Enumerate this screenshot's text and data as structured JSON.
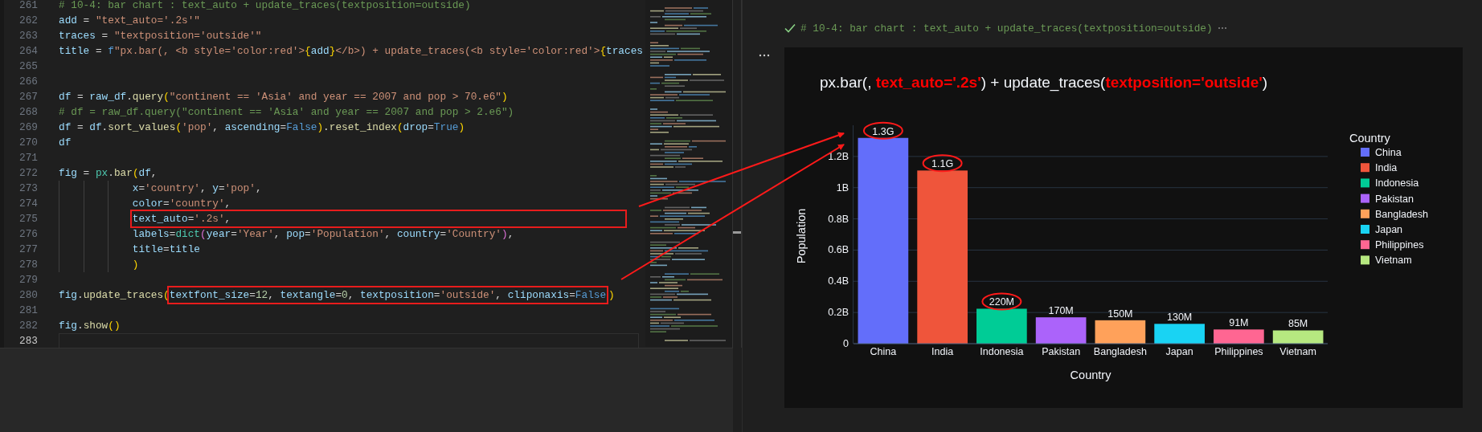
{
  "editor": {
    "lines": [
      {
        "number": "261",
        "current": false,
        "tokens": [
          {
            "kind": "comment",
            "text": "# 10-4: bar chart : text_auto + update_traces(textposition=outside)"
          }
        ]
      },
      {
        "number": "262",
        "current": false,
        "tokens": [
          {
            "kind": "var",
            "text": "add"
          },
          {
            "kind": "op",
            "text": " = "
          },
          {
            "kind": "str",
            "text": "\"text_auto='.2s'\""
          }
        ]
      },
      {
        "number": "263",
        "current": false,
        "tokens": [
          {
            "kind": "var",
            "text": "traces"
          },
          {
            "kind": "op",
            "text": " = "
          },
          {
            "kind": "str",
            "text": "\"textposition='outside'\""
          }
        ]
      },
      {
        "number": "264",
        "current": false,
        "tokens": [
          {
            "kind": "var",
            "text": "title"
          },
          {
            "kind": "op",
            "text": " = "
          },
          {
            "kind": "const",
            "text": "f"
          },
          {
            "kind": "str",
            "text": "\"px.bar(, <b style='color:red'>"
          },
          {
            "kind": "b1",
            "text": "{"
          },
          {
            "kind": "var",
            "text": "add"
          },
          {
            "kind": "b1",
            "text": "}"
          },
          {
            "kind": "str",
            "text": "</b>) + update_traces(<b style='color:red'>"
          },
          {
            "kind": "b1",
            "text": "{"
          },
          {
            "kind": "var",
            "text": "traces"
          }
        ]
      },
      {
        "number": "265",
        "current": false
      },
      {
        "number": "266",
        "current": false
      },
      {
        "number": "267",
        "current": false,
        "tokens": [
          {
            "kind": "var",
            "text": "df"
          },
          {
            "kind": "op",
            "text": " = "
          },
          {
            "kind": "var",
            "text": "raw_df"
          },
          {
            "kind": "op",
            "text": "."
          },
          {
            "kind": "func",
            "text": "query"
          },
          {
            "kind": "b1",
            "text": "("
          },
          {
            "kind": "str",
            "text": "\"continent == 'Asia' and year == 2007 and pop > 70.e6\""
          },
          {
            "kind": "b1",
            "text": ")"
          }
        ]
      },
      {
        "number": "268",
        "current": false,
        "tokens": [
          {
            "kind": "comment",
            "text": "# df = raw_df.query(\"continent == 'Asia' and year == 2007 and pop > 2.e6\")"
          }
        ]
      },
      {
        "number": "269",
        "current": false,
        "tokens": [
          {
            "kind": "var",
            "text": "df"
          },
          {
            "kind": "op",
            "text": " = "
          },
          {
            "kind": "var",
            "text": "df"
          },
          {
            "kind": "op",
            "text": "."
          },
          {
            "kind": "func",
            "text": "sort_values"
          },
          {
            "kind": "b1",
            "text": "("
          },
          {
            "kind": "str",
            "text": "'pop'"
          },
          {
            "kind": "op",
            "text": ", "
          },
          {
            "kind": "var",
            "text": "ascending"
          },
          {
            "kind": "op",
            "text": "="
          },
          {
            "kind": "const",
            "text": "False"
          },
          {
            "kind": "b1",
            "text": ")"
          },
          {
            "kind": "op",
            "text": "."
          },
          {
            "kind": "func",
            "text": "reset_index"
          },
          {
            "kind": "b1",
            "text": "("
          },
          {
            "kind": "var",
            "text": "drop"
          },
          {
            "kind": "op",
            "text": "="
          },
          {
            "kind": "const",
            "text": "True"
          },
          {
            "kind": "b1",
            "text": ")"
          }
        ]
      },
      {
        "number": "270",
        "current": false,
        "tokens": [
          {
            "kind": "var",
            "text": "df"
          }
        ]
      },
      {
        "number": "271",
        "current": false
      },
      {
        "number": "272",
        "current": false,
        "tokens": [
          {
            "kind": "var",
            "text": "fig"
          },
          {
            "kind": "op",
            "text": " = "
          },
          {
            "kind": "class",
            "text": "px"
          },
          {
            "kind": "op",
            "text": "."
          },
          {
            "kind": "func",
            "text": "bar"
          },
          {
            "kind": "b1",
            "text": "("
          },
          {
            "kind": "var",
            "text": "df"
          },
          {
            "kind": "op",
            "text": ","
          }
        ]
      },
      {
        "number": "273",
        "current": false,
        "indented": true,
        "tokens": [
          {
            "kind": "var",
            "text": "x"
          },
          {
            "kind": "op",
            "text": "="
          },
          {
            "kind": "str",
            "text": "'country'"
          },
          {
            "kind": "op",
            "text": ", "
          },
          {
            "kind": "var",
            "text": "y"
          },
          {
            "kind": "op",
            "text": "="
          },
          {
            "kind": "str",
            "text": "'pop'"
          },
          {
            "kind": "op",
            "text": ","
          }
        ]
      },
      {
        "number": "274",
        "current": false,
        "indented": true,
        "tokens": [
          {
            "kind": "var",
            "text": "color"
          },
          {
            "kind": "op",
            "text": "="
          },
          {
            "kind": "str",
            "text": "'country'"
          },
          {
            "kind": "op",
            "text": ","
          }
        ]
      },
      {
        "number": "275",
        "current": false,
        "indented": true,
        "segments": [
          {
            "highlighted": true,
            "tokens": [
              {
                "kind": "var",
                "text": "text_auto"
              },
              {
                "kind": "op",
                "text": "="
              },
              {
                "kind": "str",
                "text": "'.2s'"
              },
              {
                "kind": "op",
                "text": ","
              }
            ]
          }
        ]
      },
      {
        "number": "276",
        "current": false,
        "indented": true,
        "tokens": [
          {
            "kind": "var",
            "text": "labels"
          },
          {
            "kind": "op",
            "text": "="
          },
          {
            "kind": "class",
            "text": "dict"
          },
          {
            "kind": "b2",
            "text": "("
          },
          {
            "kind": "var",
            "text": "year"
          },
          {
            "kind": "op",
            "text": "="
          },
          {
            "kind": "str",
            "text": "'Year'"
          },
          {
            "kind": "op",
            "text": ", "
          },
          {
            "kind": "var",
            "text": "pop"
          },
          {
            "kind": "op",
            "text": "="
          },
          {
            "kind": "str",
            "text": "'Population'"
          },
          {
            "kind": "op",
            "text": ", "
          },
          {
            "kind": "var",
            "text": "country"
          },
          {
            "kind": "op",
            "text": "="
          },
          {
            "kind": "str",
            "text": "'Country'"
          },
          {
            "kind": "b2",
            "text": ")"
          },
          {
            "kind": "op",
            "text": ","
          }
        ]
      },
      {
        "number": "277",
        "current": false,
        "indented": true,
        "tokens": [
          {
            "kind": "var",
            "text": "title"
          },
          {
            "kind": "op",
            "text": "="
          },
          {
            "kind": "var",
            "text": "title"
          }
        ]
      },
      {
        "number": "278",
        "current": false,
        "indented": true,
        "tokens": [
          {
            "kind": "b1",
            "text": ")"
          }
        ]
      },
      {
        "number": "279",
        "current": false
      },
      {
        "number": "280",
        "current": false,
        "segments": [
          {
            "highlighted": false,
            "tokens": [
              {
                "kind": "var",
                "text": "fig"
              },
              {
                "kind": "op",
                "text": "."
              },
              {
                "kind": "func",
                "text": "update_traces"
              },
              {
                "kind": "b1",
                "text": "("
              }
            ]
          },
          {
            "highlighted": true,
            "tokens": [
              {
                "kind": "var",
                "text": "textfont_size"
              },
              {
                "kind": "op",
                "text": "="
              },
              {
                "kind": "num",
                "text": "12"
              },
              {
                "kind": "op",
                "text": ", "
              },
              {
                "kind": "var",
                "text": "textangle"
              },
              {
                "kind": "op",
                "text": "="
              },
              {
                "kind": "num",
                "text": "0"
              },
              {
                "kind": "op",
                "text": ", "
              },
              {
                "kind": "var",
                "text": "textposition"
              },
              {
                "kind": "op",
                "text": "="
              },
              {
                "kind": "str",
                "text": "'outside'"
              },
              {
                "kind": "op",
                "text": ", "
              },
              {
                "kind": "var",
                "text": "cliponaxis"
              },
              {
                "kind": "op",
                "text": "="
              },
              {
                "kind": "const",
                "text": "False"
              }
            ]
          },
          {
            "highlighted": false,
            "tokens": [
              {
                "kind": "b1",
                "text": ")"
              }
            ]
          }
        ]
      },
      {
        "number": "281",
        "current": false
      },
      {
        "number": "282",
        "current": false,
        "tokens": [
          {
            "kind": "var",
            "text": "fig"
          },
          {
            "kind": "op",
            "text": "."
          },
          {
            "kind": "func",
            "text": "show"
          },
          {
            "kind": "b1",
            "text": "()"
          }
        ]
      },
      {
        "number": "283",
        "current": true
      }
    ]
  },
  "output_cell": {
    "title": "# 10-4: bar chart : text_auto + update_traces(textposition=outside)",
    "succeeded": true,
    "chart_data": {
      "type": "bar",
      "title": "px.bar(, **text_auto='.2s'**) + update_traces(**textposition='outside'**)",
      "xlabel": "Country",
      "ylabel": "Population",
      "legend_title": "Country",
      "categories": [
        "China",
        "India",
        "Indonesia",
        "Pakistan",
        "Bangladesh",
        "Japan",
        "Philippines",
        "Vietnam"
      ],
      "series": [
        {
          "name": "China",
          "color": "#636efa",
          "values": [
            1.319,
            null,
            null,
            null,
            null,
            null,
            null,
            null
          ]
        },
        {
          "name": "India",
          "color": "#ef553b",
          "values": [
            null,
            1.11,
            null,
            null,
            null,
            null,
            null,
            null
          ]
        },
        {
          "name": "Indonesia",
          "color": "#00cc96",
          "values": [
            null,
            null,
            0.224,
            null,
            null,
            null,
            null,
            null
          ]
        },
        {
          "name": "Pakistan",
          "color": "#ab63fa",
          "values": [
            null,
            null,
            null,
            0.169,
            null,
            null,
            null,
            null
          ]
        },
        {
          "name": "Bangladesh",
          "color": "#ffa15a",
          "values": [
            null,
            null,
            null,
            null,
            0.15,
            null,
            null,
            null
          ]
        },
        {
          "name": "Japan",
          "color": "#19d3f3",
          "values": [
            null,
            null,
            null,
            null,
            null,
            0.127,
            null,
            null
          ]
        },
        {
          "name": "Philippines",
          "color": "#ff6692",
          "values": [
            null,
            null,
            null,
            null,
            null,
            null,
            0.091,
            null
          ]
        },
        {
          "name": "Vietnam",
          "color": "#b6e880",
          "values": [
            null,
            null,
            null,
            null,
            null,
            null,
            null,
            0.085
          ]
        }
      ],
      "value_labels": [
        "1.3G",
        "1.1G",
        "220M",
        "170M",
        "150M",
        "130M",
        "91M",
        "85M"
      ],
      "grid": true,
      "legend": "right",
      "ylim": [
        0,
        1.4
      ],
      "yticks": [
        {
          "value": 0,
          "label": "0"
        },
        {
          "value": 0.2,
          "label": "0.2B"
        },
        {
          "value": 0.4,
          "label": "0.4B"
        },
        {
          "value": 0.6,
          "label": "0.6B"
        },
        {
          "value": 0.8,
          "label": "0.8B"
        },
        {
          "value": 1,
          "label": "1B"
        },
        {
          "value": 1.2,
          "label": "1.2B"
        }
      ]
    }
  }
}
